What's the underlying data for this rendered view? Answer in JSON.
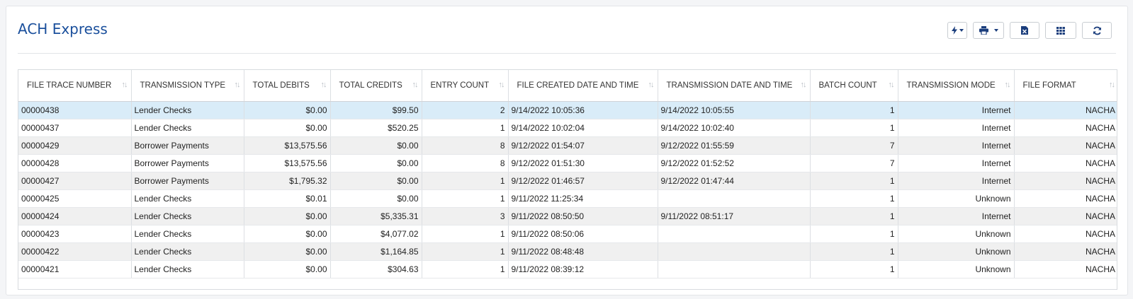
{
  "page": {
    "title": "ACH Express"
  },
  "toolbar": {
    "buttons": [
      {
        "name": "actions-menu-button",
        "icon": "lightning-icon",
        "has_dropdown": true
      },
      {
        "name": "print-menu-button",
        "icon": "print-icon",
        "has_dropdown": true
      },
      {
        "name": "export-excel-button",
        "icon": "excel-icon",
        "has_dropdown": false
      },
      {
        "name": "column-chooser-button",
        "icon": "grid-icon",
        "has_dropdown": false
      },
      {
        "name": "refresh-button",
        "icon": "refresh-icon",
        "has_dropdown": false
      }
    ]
  },
  "table": {
    "columns": [
      "FILE TRACE NUMBER",
      "TRANSMISSION TYPE",
      "TOTAL DEBITS",
      "TOTAL CREDITS",
      "ENTRY COUNT",
      "FILE CREATED DATE AND TIME",
      "TRANSMISSION DATE AND TIME",
      "BATCH COUNT",
      "TRANSMISSION MODE",
      "FILE FORMAT"
    ],
    "sort_icon": "↑↓",
    "rows": [
      [
        "00000438",
        "Lender Checks",
        "$0.00",
        "$99.50",
        "2",
        "9/14/2022 10:05:36",
        "9/14/2022 10:05:55",
        "1",
        "Internet",
        "NACHA"
      ],
      [
        "00000437",
        "Lender Checks",
        "$0.00",
        "$520.25",
        "1",
        "9/14/2022 10:02:04",
        "9/14/2022 10:02:40",
        "1",
        "Internet",
        "NACHA"
      ],
      [
        "00000429",
        "Borrower Payments",
        "$13,575.56",
        "$0.00",
        "8",
        "9/12/2022 01:54:07",
        "9/12/2022 01:55:59",
        "7",
        "Internet",
        "NACHA"
      ],
      [
        "00000428",
        "Borrower Payments",
        "$13,575.56",
        "$0.00",
        "8",
        "9/12/2022 01:51:30",
        "9/12/2022 01:52:52",
        "7",
        "Internet",
        "NACHA"
      ],
      [
        "00000427",
        "Borrower Payments",
        "$1,795.32",
        "$0.00",
        "1",
        "9/12/2022 01:46:57",
        "9/12/2022 01:47:44",
        "1",
        "Internet",
        "NACHA"
      ],
      [
        "00000425",
        "Lender Checks",
        "$0.01",
        "$0.00",
        "1",
        "9/11/2022 11:25:34",
        "",
        "1",
        "Unknown",
        "NACHA"
      ],
      [
        "00000424",
        "Lender Checks",
        "$0.00",
        "$5,335.31",
        "3",
        "9/11/2022 08:50:50",
        "9/11/2022 08:51:17",
        "1",
        "Internet",
        "NACHA"
      ],
      [
        "00000423",
        "Lender Checks",
        "$0.00",
        "$4,077.02",
        "1",
        "9/11/2022 08:50:06",
        "",
        "1",
        "Unknown",
        "NACHA"
      ],
      [
        "00000422",
        "Lender Checks",
        "$0.00",
        "$1,164.85",
        "1",
        "9/11/2022 08:48:48",
        "",
        "1",
        "Unknown",
        "NACHA"
      ],
      [
        "00000421",
        "Lender Checks",
        "$0.00",
        "$304.63",
        "1",
        "9/11/2022 08:39:12",
        "",
        "1",
        "Unknown",
        "NACHA"
      ]
    ],
    "selected_row": 0
  },
  "colors": {
    "title": "#1a4f9c",
    "selected_row": "#d9ecf8",
    "alt_row": "#f0f0f0"
  }
}
